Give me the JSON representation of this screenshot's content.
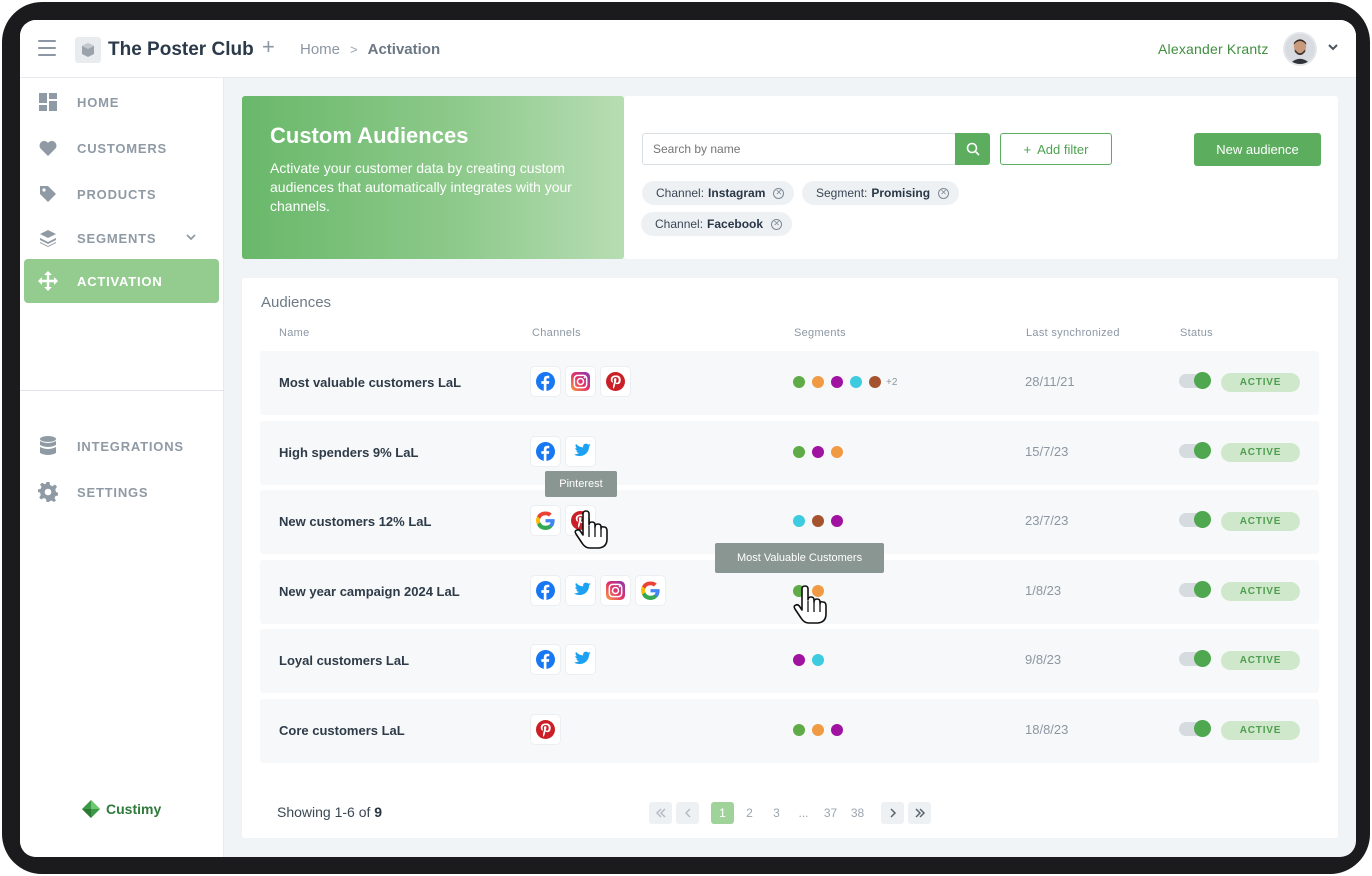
{
  "header": {
    "brand_name": "The Poster Club",
    "breadcrumb": [
      "Home",
      "Activation"
    ],
    "user_name": "Alexander Krantz"
  },
  "sidebar": {
    "items": [
      {
        "label": "HOME",
        "icon": "dashboard-icon"
      },
      {
        "label": "CUSTOMERS",
        "icon": "heart-icon"
      },
      {
        "label": "PRODUCTS",
        "icon": "tag-icon"
      },
      {
        "label": "SEGMENTS",
        "icon": "layers-icon"
      },
      {
        "label": "ACTIVATION",
        "icon": "move-arrows-icon",
        "active": true
      },
      {
        "label": "INTEGRATIONS",
        "icon": "database-icon"
      },
      {
        "label": "SETTINGS",
        "icon": "gear-icon"
      }
    ],
    "footer_logo": "Custimy"
  },
  "hero": {
    "title": "Custom Audiences",
    "description": "Activate your customer data by creating custom audiences that automatically integrates with your channels."
  },
  "filters": {
    "search_placeholder": "Search by name",
    "add_filter_label": "Add filter",
    "new_audience_label": "New audience",
    "chips": [
      {
        "key": "Channel:",
        "value": "Instagram"
      },
      {
        "key": "Segment:",
        "value": "Promising"
      },
      {
        "key": "Channel:",
        "value": "Facebook"
      }
    ]
  },
  "audiences": {
    "title": "Audiences",
    "columns": [
      "Name",
      "Channels",
      "Segments",
      "Last synchronized",
      "Status"
    ],
    "rows": [
      {
        "name": "Most valuable customers LaL",
        "channels": [
          "facebook",
          "instagram",
          "pinterest"
        ],
        "segments": [
          "#5eab47",
          "#f09a43",
          "#a012a0",
          "#3dcbe0",
          "#a5532e"
        ],
        "extra_segments": "+2",
        "date": "28/11/21",
        "status": "ACTIVE"
      },
      {
        "name": "High spenders 9% LaL",
        "channels": [
          "facebook",
          "twitter"
        ],
        "segments": [
          "#5eab47",
          "#a012a0",
          "#f09a43"
        ],
        "extra_segments": "",
        "date": "15/7/23",
        "status": "ACTIVE"
      },
      {
        "name": "New customers 12% LaL",
        "channels": [
          "google",
          "pinterest"
        ],
        "segments": [
          "#3dcbe0",
          "#a5532e",
          "#a012a0"
        ],
        "extra_segments": "",
        "date": "23/7/23",
        "status": "ACTIVE"
      },
      {
        "name": "New year campaign 2024 LaL",
        "channels": [
          "facebook",
          "twitter",
          "instagram",
          "google"
        ],
        "segments": [
          "#5eab47",
          "#f09a43"
        ],
        "extra_segments": "",
        "date": "1/8/23",
        "status": "ACTIVE"
      },
      {
        "name": "Loyal customers LaL",
        "channels": [
          "facebook",
          "twitter"
        ],
        "segments": [
          "#a012a0",
          "#3dcbe0"
        ],
        "extra_segments": "",
        "date": "9/8/23",
        "status": "ACTIVE"
      },
      {
        "name": "Core customers LaL",
        "channels": [
          "pinterest"
        ],
        "segments": [
          "#5eab47",
          "#f09a43",
          "#a012a0"
        ],
        "extra_segments": "",
        "date": "18/8/23",
        "status": "ACTIVE"
      }
    ],
    "showing_prefix": "Showing 1-6 of",
    "showing_total": "9",
    "pagination": [
      "1",
      "2",
      "3",
      "...",
      "37",
      "38"
    ],
    "current_page": "1"
  },
  "tooltips": {
    "channel": "Pinterest",
    "segment": "Most Valuable Customers"
  },
  "colors": {
    "accent": "#5cae5e",
    "active_nav": "#93cc8e",
    "status_bg": "#cfe8cc"
  }
}
